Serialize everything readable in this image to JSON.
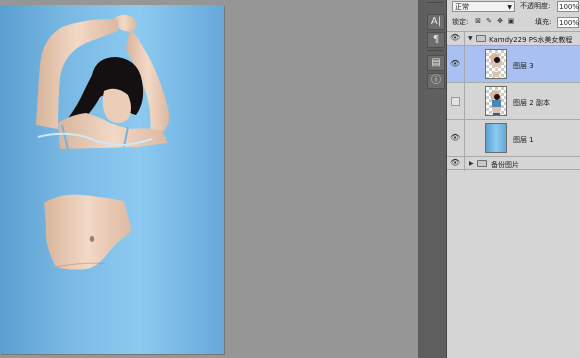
{
  "blend_mode": "正常",
  "opacity_label": "不透明度:",
  "opacity_value": "100%",
  "lock_label": "锁定:",
  "fill_label": "填充:",
  "fill_value": "100%",
  "group_top": {
    "name": "Kamdy229 PS水美女教程",
    "expanded": true
  },
  "layers": [
    {
      "name": "图层 3",
      "visible": true,
      "selected": true,
      "thumb": "figure-top"
    },
    {
      "name": "图层 2 副本",
      "visible": false,
      "selected": false,
      "thumb": "figure-full"
    },
    {
      "name": "图层 1",
      "visible": true,
      "selected": false,
      "thumb": "gradient"
    }
  ],
  "group_bottom": {
    "name": "备份图片",
    "expanded": false
  },
  "tool_icons": [
    "tool-a-icon",
    "paragraph-icon",
    "layer-comps-icon",
    "info-icon"
  ],
  "colors": {
    "canvas_gradient": [
      "#5a9fd0",
      "#8ccaf0",
      "#66a8d9"
    ],
    "selected_layer": "#a9c1f2",
    "panel_bg": "#d5d5d5"
  }
}
